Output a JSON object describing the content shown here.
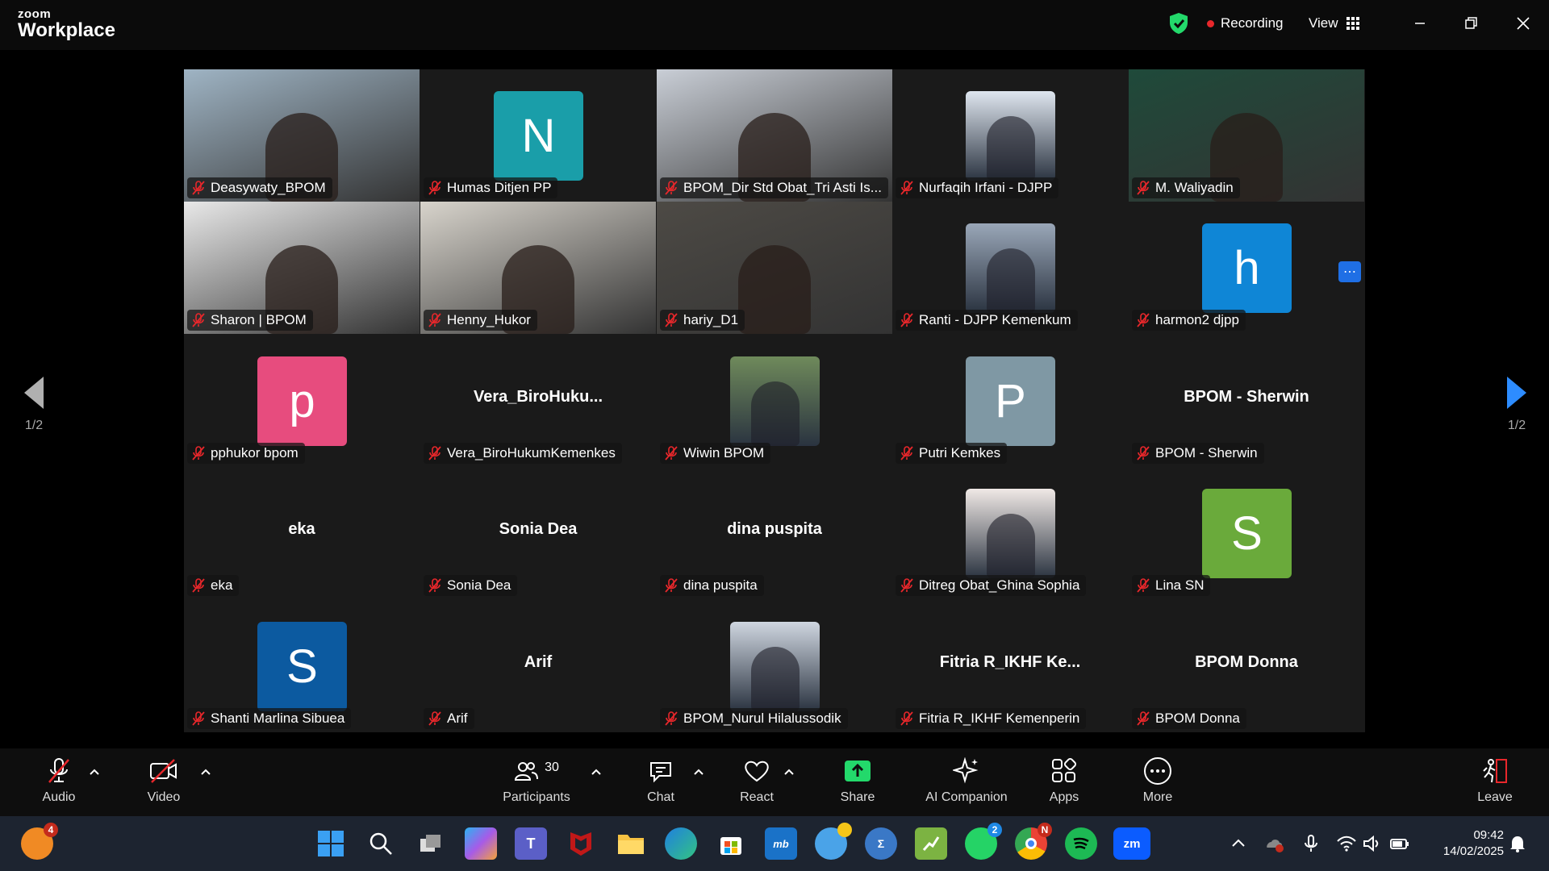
{
  "app": {
    "brand_small": "zoom",
    "brand_big": "Workplace"
  },
  "header": {
    "recording_label": "Recording",
    "view_label": "View"
  },
  "pager": {
    "left": "1/2",
    "right": "1/2"
  },
  "participants": [
    {
      "name": "Deasywaty_BPOM",
      "type": "video",
      "bg": "#9fb4c4"
    },
    {
      "name": "Humas Ditjen PP",
      "type": "avatar",
      "letter": "N",
      "color": "#1a9ea9"
    },
    {
      "name": "BPOM_Dir Std Obat_Tri Asti Is...",
      "type": "video",
      "bg": "#c9ced6"
    },
    {
      "name": "Nurfaqih Irfani - DJPP",
      "type": "photo",
      "bg": "#dfe6ef"
    },
    {
      "name": "M. Waliyadin",
      "type": "video",
      "bg": "#1f4a3a",
      "active": true
    },
    {
      "name": "Sharon | BPOM",
      "type": "video",
      "bg": "#e8e8e8"
    },
    {
      "name": "Henny_Hukor",
      "type": "video",
      "bg": "#d8d4cc"
    },
    {
      "name": "hariy_D1",
      "type": "video",
      "bg": "#4d4a45"
    },
    {
      "name": "Ranti - DJPP Kemenkum",
      "type": "photo",
      "bg": "#9aa7b8"
    },
    {
      "name": "harmon2 djpp",
      "type": "avatar",
      "letter": "h",
      "color": "#0f86d6"
    },
    {
      "name": "pphukor bpom",
      "type": "avatar",
      "letter": "p",
      "color": "#e74c7e"
    },
    {
      "name": "Vera_BiroHukumKemenkes",
      "type": "text",
      "display": "Vera_BiroHuku..."
    },
    {
      "name": "Wiwin BPOM",
      "type": "photo",
      "bg": "#6f8a5b"
    },
    {
      "name": "Putri Kemkes",
      "type": "avatar",
      "letter": "P",
      "color": "#7f98a4"
    },
    {
      "name": "BPOM - Sherwin",
      "type": "text",
      "display": "BPOM - Sherwin"
    },
    {
      "name": "eka",
      "type": "text",
      "display": "eka"
    },
    {
      "name": "Sonia Dea",
      "type": "text",
      "display": "Sonia Dea"
    },
    {
      "name": "dina puspita",
      "type": "text",
      "display": "dina puspita"
    },
    {
      "name": "Ditreg Obat_Ghina Sophia",
      "type": "photo",
      "bg": "#f0e9e6"
    },
    {
      "name": "Lina SN",
      "type": "avatar",
      "letter": "S",
      "color": "#6aaa3b"
    },
    {
      "name": "Shanti Marlina Sibuea",
      "type": "avatar",
      "letter": "S",
      "color": "#0c5aa0"
    },
    {
      "name": "Arif",
      "type": "text",
      "display": "Arif"
    },
    {
      "name": "BPOM_Nurul Hilalussodik",
      "type": "photo",
      "bg": "#cfd6e0"
    },
    {
      "name": "Fitria R_IKHF Kemenperin",
      "type": "text",
      "display": "Fitria R_IKHF Ke..."
    },
    {
      "name": "BPOM Donna",
      "type": "text",
      "display": "BPOM Donna"
    }
  ],
  "toolbar": {
    "audio": "Audio",
    "video": "Video",
    "participants": "Participants",
    "participants_count": "30",
    "chat": "Chat",
    "react": "React",
    "share": "Share",
    "ai_companion": "AI Companion",
    "apps": "Apps",
    "more": "More",
    "leave": "Leave"
  },
  "taskbar": {
    "weather_badge": "4",
    "teams_badge": "",
    "whatsapp_badge": "2",
    "chrome_badge": "N",
    "time": "09:42",
    "date": "14/02/2025"
  },
  "colors": {
    "accent_green": "#23d96b",
    "share_green": "#23d96b",
    "record_red": "#e8272b"
  }
}
